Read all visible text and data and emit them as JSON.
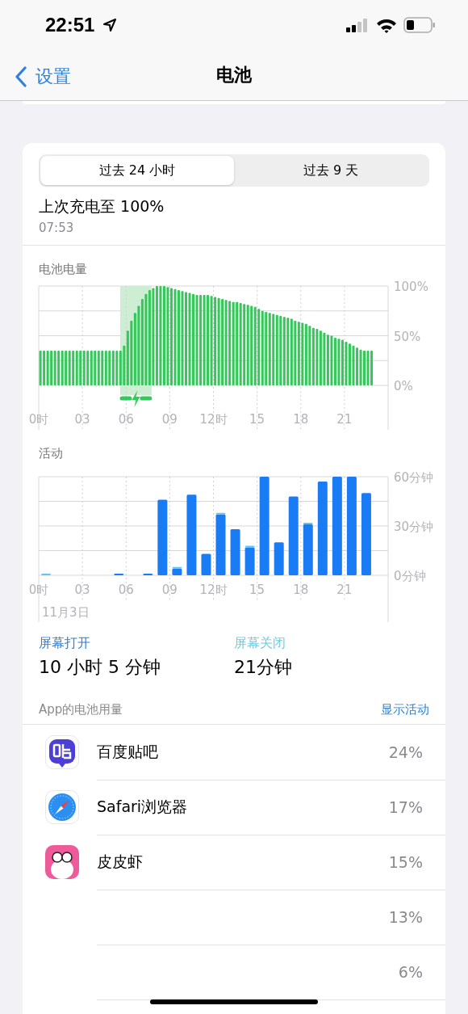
{
  "status_bar": {
    "time": "22:51"
  },
  "nav": {
    "back": "设置",
    "title": "电池"
  },
  "tabs": [
    {
      "label": "过去 24 小时",
      "selected": true
    },
    {
      "label": "过去 9 天",
      "selected": false
    }
  ],
  "last_charge": {
    "title": "上次充电至 100%",
    "time": "07:53"
  },
  "battery_chart": {
    "title": "电池电量",
    "chart_data": {
      "type": "bar",
      "grid": true,
      "xlim": [
        0,
        24
      ],
      "ylim": [
        0,
        100
      ],
      "x": [
        0,
        0.25,
        0.5,
        0.75,
        1,
        1.25,
        1.5,
        1.75,
        2,
        2.25,
        2.5,
        2.75,
        3,
        3.25,
        3.5,
        3.75,
        4,
        4.25,
        4.5,
        4.75,
        5,
        5.25,
        5.5,
        5.75,
        6,
        6.25,
        6.5,
        6.75,
        7,
        7.25,
        7.5,
        7.75,
        8,
        8.25,
        8.5,
        8.75,
        9,
        9.25,
        9.5,
        9.75,
        10,
        10.25,
        10.5,
        10.75,
        11,
        11.25,
        11.5,
        11.75,
        12,
        12.25,
        12.5,
        12.75,
        13,
        13.25,
        13.5,
        13.75,
        14,
        14.25,
        14.5,
        14.75,
        15,
        15.25,
        15.5,
        15.75,
        16,
        16.25,
        16.5,
        16.75,
        17,
        17.25,
        17.5,
        17.75,
        18,
        18.25,
        18.5,
        18.75,
        19,
        19.25,
        19.5,
        19.75,
        20,
        20.25,
        20.5,
        20.75,
        21,
        21.25,
        21.5,
        21.75,
        22,
        22.25,
        22.5,
        22.75
      ],
      "values": [
        35,
        35,
        35,
        35,
        35,
        35,
        35,
        35,
        35,
        35,
        35,
        35,
        35,
        35,
        35,
        35,
        35,
        35,
        35,
        35,
        35,
        35,
        35,
        40,
        55,
        65,
        73,
        80,
        87,
        92,
        96,
        98,
        100,
        100,
        100,
        99,
        98,
        97,
        96,
        95,
        94,
        93,
        92,
        91,
        91,
        91,
        91,
        90,
        89,
        88,
        87,
        86,
        85,
        84,
        84,
        83,
        82,
        81,
        80,
        79,
        77,
        75,
        74,
        73,
        72,
        71,
        70,
        69,
        68,
        67,
        65,
        64,
        63,
        62,
        60,
        58,
        57,
        55,
        53,
        51,
        50,
        48,
        47,
        46,
        44,
        42,
        40,
        38,
        36,
        35,
        35,
        35
      ],
      "xticks": [
        {
          "value": 0,
          "label": "0时"
        },
        {
          "value": 3,
          "label": "03"
        },
        {
          "value": 6,
          "label": "06"
        },
        {
          "value": 9,
          "label": "09"
        },
        {
          "value": 12,
          "label": "12时"
        },
        {
          "value": 15,
          "label": "15"
        },
        {
          "value": 18,
          "label": "18"
        },
        {
          "value": 21,
          "label": "21"
        }
      ],
      "yticks": [
        {
          "value": 0,
          "label": "0%"
        },
        {
          "value": 50,
          "label": "50%"
        },
        {
          "value": 100,
          "label": "100%"
        }
      ],
      "bands": [
        {
          "axis": "x",
          "from": 5.6,
          "to": 7.75,
          "color": "#cdeed3"
        }
      ]
    }
  },
  "activity_chart": {
    "title": "活动",
    "date": "11月3日",
    "chart_data": {
      "type": "bar",
      "stacked": true,
      "grid": true,
      "xlim": [
        0,
        24
      ],
      "ylim": [
        0,
        60
      ],
      "x": [
        0.5,
        1.5,
        2.5,
        3.5,
        4.5,
        5.5,
        6.5,
        7.5,
        8.5,
        9.5,
        10.5,
        11.5,
        12.5,
        13.5,
        14.5,
        15.5,
        16.5,
        17.5,
        18.5,
        19.5,
        20.5,
        21.5,
        22.5
      ],
      "series": [
        {
          "color": "#1a7cf5",
          "values": [
            0,
            0,
            0,
            0,
            0,
            1,
            0,
            1,
            46,
            4,
            49,
            13,
            37,
            28,
            17,
            60,
            20,
            48,
            31,
            57,
            60,
            60,
            50
          ]
        },
        {
          "color": "#63c6ea",
          "values": [
            1,
            0,
            0,
            0,
            0,
            0,
            0,
            0,
            0,
            1,
            0,
            0,
            1,
            0,
            1,
            0,
            0,
            0,
            1,
            0,
            0,
            0,
            0
          ]
        }
      ],
      "xticks": [
        {
          "value": 0,
          "label": "0时"
        },
        {
          "value": 3,
          "label": "03"
        },
        {
          "value": 6,
          "label": "06"
        },
        {
          "value": 9,
          "label": "09"
        },
        {
          "value": 12,
          "label": "12时"
        },
        {
          "value": 15,
          "label": "15"
        },
        {
          "value": 18,
          "label": "18"
        },
        {
          "value": 21,
          "label": "21"
        }
      ],
      "yticks": [
        {
          "value": 0,
          "label": "0分钟"
        },
        {
          "value": 30,
          "label": "30分钟"
        },
        {
          "value": 60,
          "label": "60分钟"
        }
      ]
    }
  },
  "screen_stats": [
    {
      "label": "屏幕打开",
      "value": "10 小时 5 分钟",
      "color": "#2f7fd0"
    },
    {
      "label": "屏幕关闭",
      "value": "21分钟",
      "color": "#6ccbe3"
    }
  ],
  "apps_header": {
    "title": "App的电池用量",
    "action": "显示活动"
  },
  "apps": [
    {
      "name": "百度贴吧",
      "percent": "24%"
    },
    {
      "name": "Safari浏览器",
      "percent": "17%"
    },
    {
      "name": "皮皮虾",
      "percent": "15%"
    },
    {
      "percent": "13%"
    },
    {
      "percent": "6%"
    }
  ]
}
